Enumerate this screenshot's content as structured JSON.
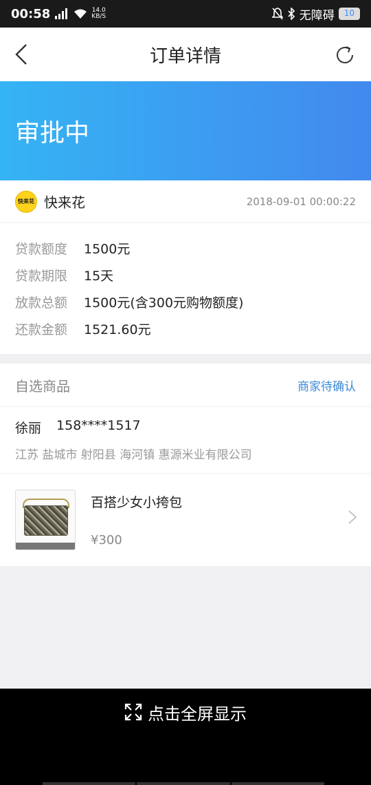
{
  "status_bar": {
    "time": "00:58",
    "network_speed_value": "14.0",
    "network_speed_unit": "KB/S",
    "accessibility_label": "无障碍",
    "battery_level": "10"
  },
  "header": {
    "title": "订单详情"
  },
  "banner": {
    "status": "审批中"
  },
  "merchant": {
    "logo_text": "快来花",
    "name": "快来花",
    "order_time": "2018-09-01 00:00:22"
  },
  "loan_details": [
    {
      "label": "贷款额度",
      "value": "1500元"
    },
    {
      "label": "贷款期限",
      "value": "15天"
    },
    {
      "label": "放款总额",
      "value": "1500元(含300元购物额度)"
    },
    {
      "label": "还款金额",
      "value": "1521.60元"
    }
  ],
  "goods": {
    "section_title": "自选商品",
    "status": "商家待确认",
    "receiver_name": "徐丽",
    "receiver_phone": "158****1517",
    "address": "江苏 盐城市 射阳县 海河镇 惠源米业有限公司",
    "product_name": "百搭少女小挎包",
    "product_price": "¥300"
  },
  "bottom": {
    "fullscreen_label": "点击全屏显示"
  },
  "colors": {
    "banner_start": "#35b4f4",
    "banner_end": "#4289ee",
    "status_link": "#3b8ad8",
    "logo_bg": "#ffd21c"
  }
}
